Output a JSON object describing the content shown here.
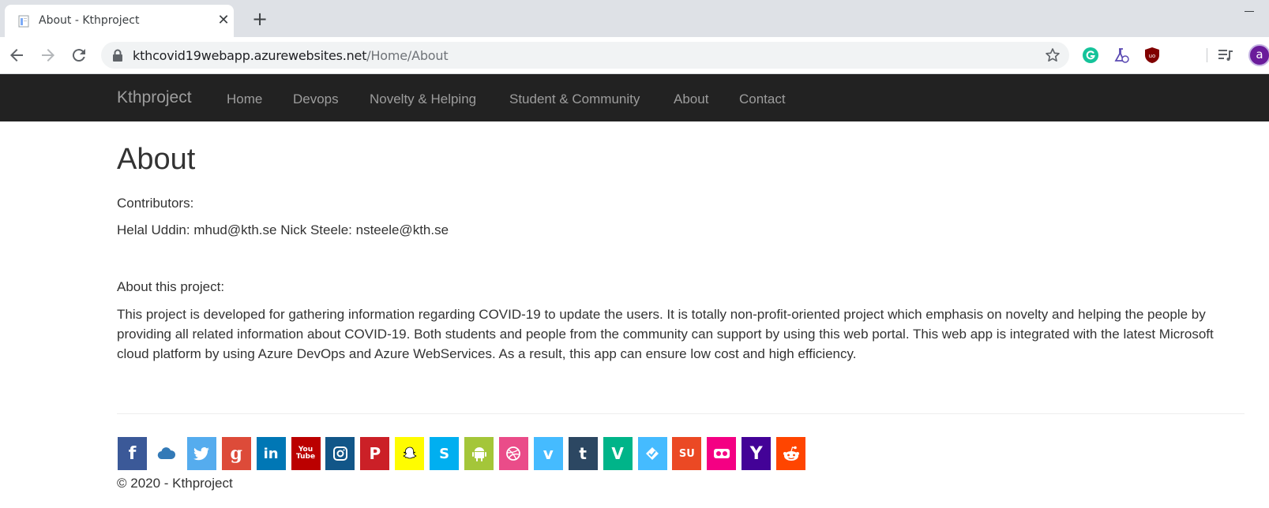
{
  "browser": {
    "tab_title": "About - Kthproject",
    "tab_close": "✕",
    "new_tab": "+",
    "url_host": "kthcovid19webapp.azurewebsites.net",
    "url_path": "/Home/About",
    "avatar_letter": "a",
    "extensions": [
      "grammarly-icon",
      "labs-flask-icon",
      "ublock-icon",
      "media-queue-icon"
    ]
  },
  "nav": {
    "brand": "Kthproject",
    "links": [
      "Home",
      "Devops",
      "Novelty & Helping",
      "Student & Community",
      "About",
      "Contact"
    ],
    "background": "#222222",
    "link_color": "#9d9d9d"
  },
  "page": {
    "title": "About",
    "contributors_label": "Contributors:",
    "contributors": "Helal Uddin: mhud@kth.se Nick Steele: nsteele@kth.se",
    "about_label": "About this project:",
    "description": "This project is developed for gathering information regarding COVID-19 to update the users. It is totally non-profit-oriented project which emphasis on novelty and helping the people by providing all related information about COVID-19. Both students and people from the community can support by using this web portal. This web app is integrated with the latest Microsoft cloud platform by using Azure DevOps and Azure WebServices. As a result, this app can ensure low cost and high efficiency."
  },
  "footer": {
    "copyright": "© 2020 - Kthproject",
    "social": [
      {
        "name": "facebook-icon",
        "glyph": "f",
        "color": "#3b5998"
      },
      {
        "name": "cloud-icon",
        "glyph": "",
        "color": "#ffffff"
      },
      {
        "name": "twitter-icon",
        "glyph": "",
        "color": "#55acee"
      },
      {
        "name": "google-plus-icon",
        "glyph": "g",
        "color": "#dd4b39"
      },
      {
        "name": "linkedin-icon",
        "glyph": "in",
        "color": "#0077b5"
      },
      {
        "name": "youtube-icon",
        "glyph": "You Tube",
        "color": "#bb0000"
      },
      {
        "name": "instagram-icon",
        "glyph": "",
        "color": "#125688"
      },
      {
        "name": "pinterest-icon",
        "glyph": "P",
        "color": "#cb2027"
      },
      {
        "name": "snapchat-icon",
        "glyph": "",
        "color": "#fffc00"
      },
      {
        "name": "skype-icon",
        "glyph": "S",
        "color": "#00aff0"
      },
      {
        "name": "android-icon",
        "glyph": "",
        "color": "#a4c639"
      },
      {
        "name": "dribbble-icon",
        "glyph": "",
        "color": "#ea4c89"
      },
      {
        "name": "vimeo-icon",
        "glyph": "v",
        "color": "#45bbff"
      },
      {
        "name": "tumblr-icon",
        "glyph": "t",
        "color": "#2c4762"
      },
      {
        "name": "vine-icon",
        "glyph": "V",
        "color": "#00b489"
      },
      {
        "name": "foursquare-icon",
        "glyph": "",
        "color": "#45bbff"
      },
      {
        "name": "stumbleupon-icon",
        "glyph": "SU",
        "color": "#eb4924"
      },
      {
        "name": "flickr-icon",
        "glyph": "",
        "color": "#f40083"
      },
      {
        "name": "yahoo-icon",
        "glyph": "Y",
        "color": "#430297"
      },
      {
        "name": "reddit-icon",
        "glyph": "",
        "color": "#ff4500"
      }
    ]
  }
}
